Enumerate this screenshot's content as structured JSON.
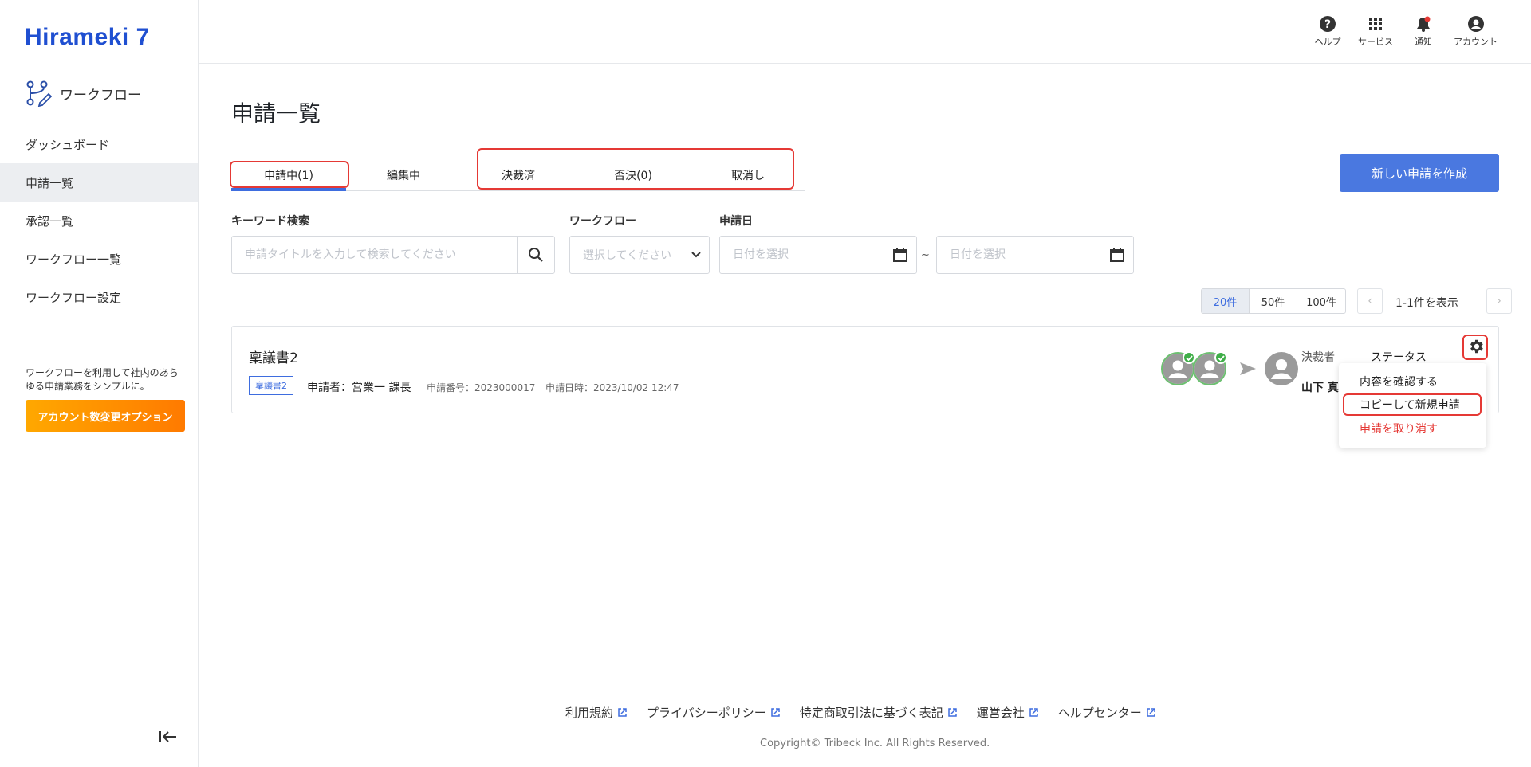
{
  "brand": {
    "logo_text": "Hirameki 7",
    "accent": "#3e6ddf",
    "logo_color": "#1f4fd1"
  },
  "sidebar": {
    "module_label": "ワークフロー",
    "items": [
      {
        "label": "ダッシュボード"
      },
      {
        "label": "申請一覧",
        "active": true
      },
      {
        "label": "承認一覧"
      },
      {
        "label": "ワークフロー一覧"
      },
      {
        "label": "ワークフロー設定"
      }
    ],
    "promo_text": "ワークフローを利用して社内のあらゆる申請業務をシンプルに。",
    "promo_button": "アカウント数変更オプション"
  },
  "topbar": {
    "help": "ヘルプ",
    "services": "サービス",
    "notifications": "通知",
    "account": "アカウント"
  },
  "page": {
    "title": "申請一覧",
    "new_button": "新しい申請を作成"
  },
  "tabs": [
    {
      "label": "申請中(1)",
      "active": true
    },
    {
      "label": "編集中"
    },
    {
      "label": "決裁済"
    },
    {
      "label": "否決(0)"
    },
    {
      "label": "取消し"
    }
  ],
  "filters": {
    "keyword_label": "キーワード検索",
    "keyword_placeholder": "申請タイトルを入力して検索してください",
    "workflow_label": "ワークフロー",
    "workflow_placeholder": "選択してください",
    "date_label": "申請日",
    "date_from_placeholder": "日付を選択",
    "date_to_placeholder": "日付を選択",
    "date_separator": "~"
  },
  "pagination": {
    "sizes": [
      "20件",
      "50件",
      "100件"
    ],
    "selected_size": "20件",
    "info": "1-1件を表示"
  },
  "request": {
    "title": "稟議書2",
    "tag": "稟議書2",
    "applicant": "申請者：営業一 課長",
    "number": "申請番号：2023000017",
    "date": "申請日時：2023/10/02 12:47",
    "approver_label": "決裁者",
    "approver_name": "山下 真",
    "status_label": "ステータス"
  },
  "menu": {
    "view": "内容を確認する",
    "copy": "コピーして新規申請",
    "cancel": "申請を取り消す"
  },
  "footer": {
    "links": [
      "利用規約",
      "プライバシーポリシー",
      "特定商取引法に基づく表記",
      "運営会社",
      "ヘルプセンター"
    ],
    "copyright": "Copyright© Tribeck Inc. All Rights Reserved."
  }
}
